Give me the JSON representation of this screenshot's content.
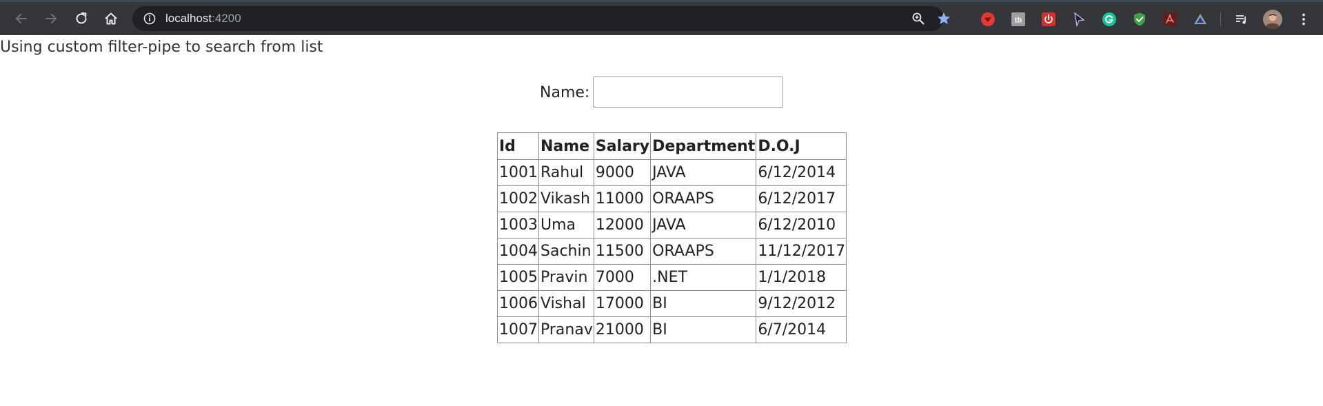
{
  "browser": {
    "url_host": "localhost",
    "url_port": ":4200",
    "accent_color": "#8ab4f8",
    "toolbar_background": "#35363a",
    "omnibox_background": "#202124",
    "nav_icons": [
      "back-icon",
      "forward-icon",
      "reload-icon",
      "home-icon"
    ],
    "omnibox_icons": [
      "info-icon",
      "zoom-icon",
      "bookmark-star-icon"
    ],
    "extension_icons": [
      "red-bird-extension-icon",
      "tb-extension-icon",
      "power-extension-icon",
      "cursor-extension-icon",
      "grammarly-extension-icon",
      "shield-check-extension-icon",
      "pdf-extension-icon",
      "triangle-extension-icon",
      "media-queue-icon",
      "profile-avatar-icon",
      "more-menu-icon"
    ]
  },
  "page": {
    "heading": "Using custom filter-pipe to search from list",
    "search": {
      "label": "Name:",
      "value": "",
      "placeholder": ""
    },
    "table": {
      "columns": [
        "Id",
        "Name",
        "Salary",
        "Department",
        "D.O.J"
      ],
      "rows": [
        [
          "1001",
          "Rahul",
          "9000",
          "JAVA",
          "6/12/2014"
        ],
        [
          "1002",
          "Vikash",
          "11000",
          "ORAAPS",
          "6/12/2017"
        ],
        [
          "1003",
          "Uma",
          "12000",
          "JAVA",
          "6/12/2010"
        ],
        [
          "1004",
          "Sachin",
          "11500",
          "ORAAPS",
          "11/12/2017"
        ],
        [
          "1005",
          "Pravin",
          "7000",
          ".NET",
          "1/1/2018"
        ],
        [
          "1006",
          "Vishal",
          "17000",
          "BI",
          "9/12/2012"
        ],
        [
          "1007",
          "Pranav",
          "21000",
          "BI",
          "6/7/2014"
        ]
      ]
    }
  }
}
